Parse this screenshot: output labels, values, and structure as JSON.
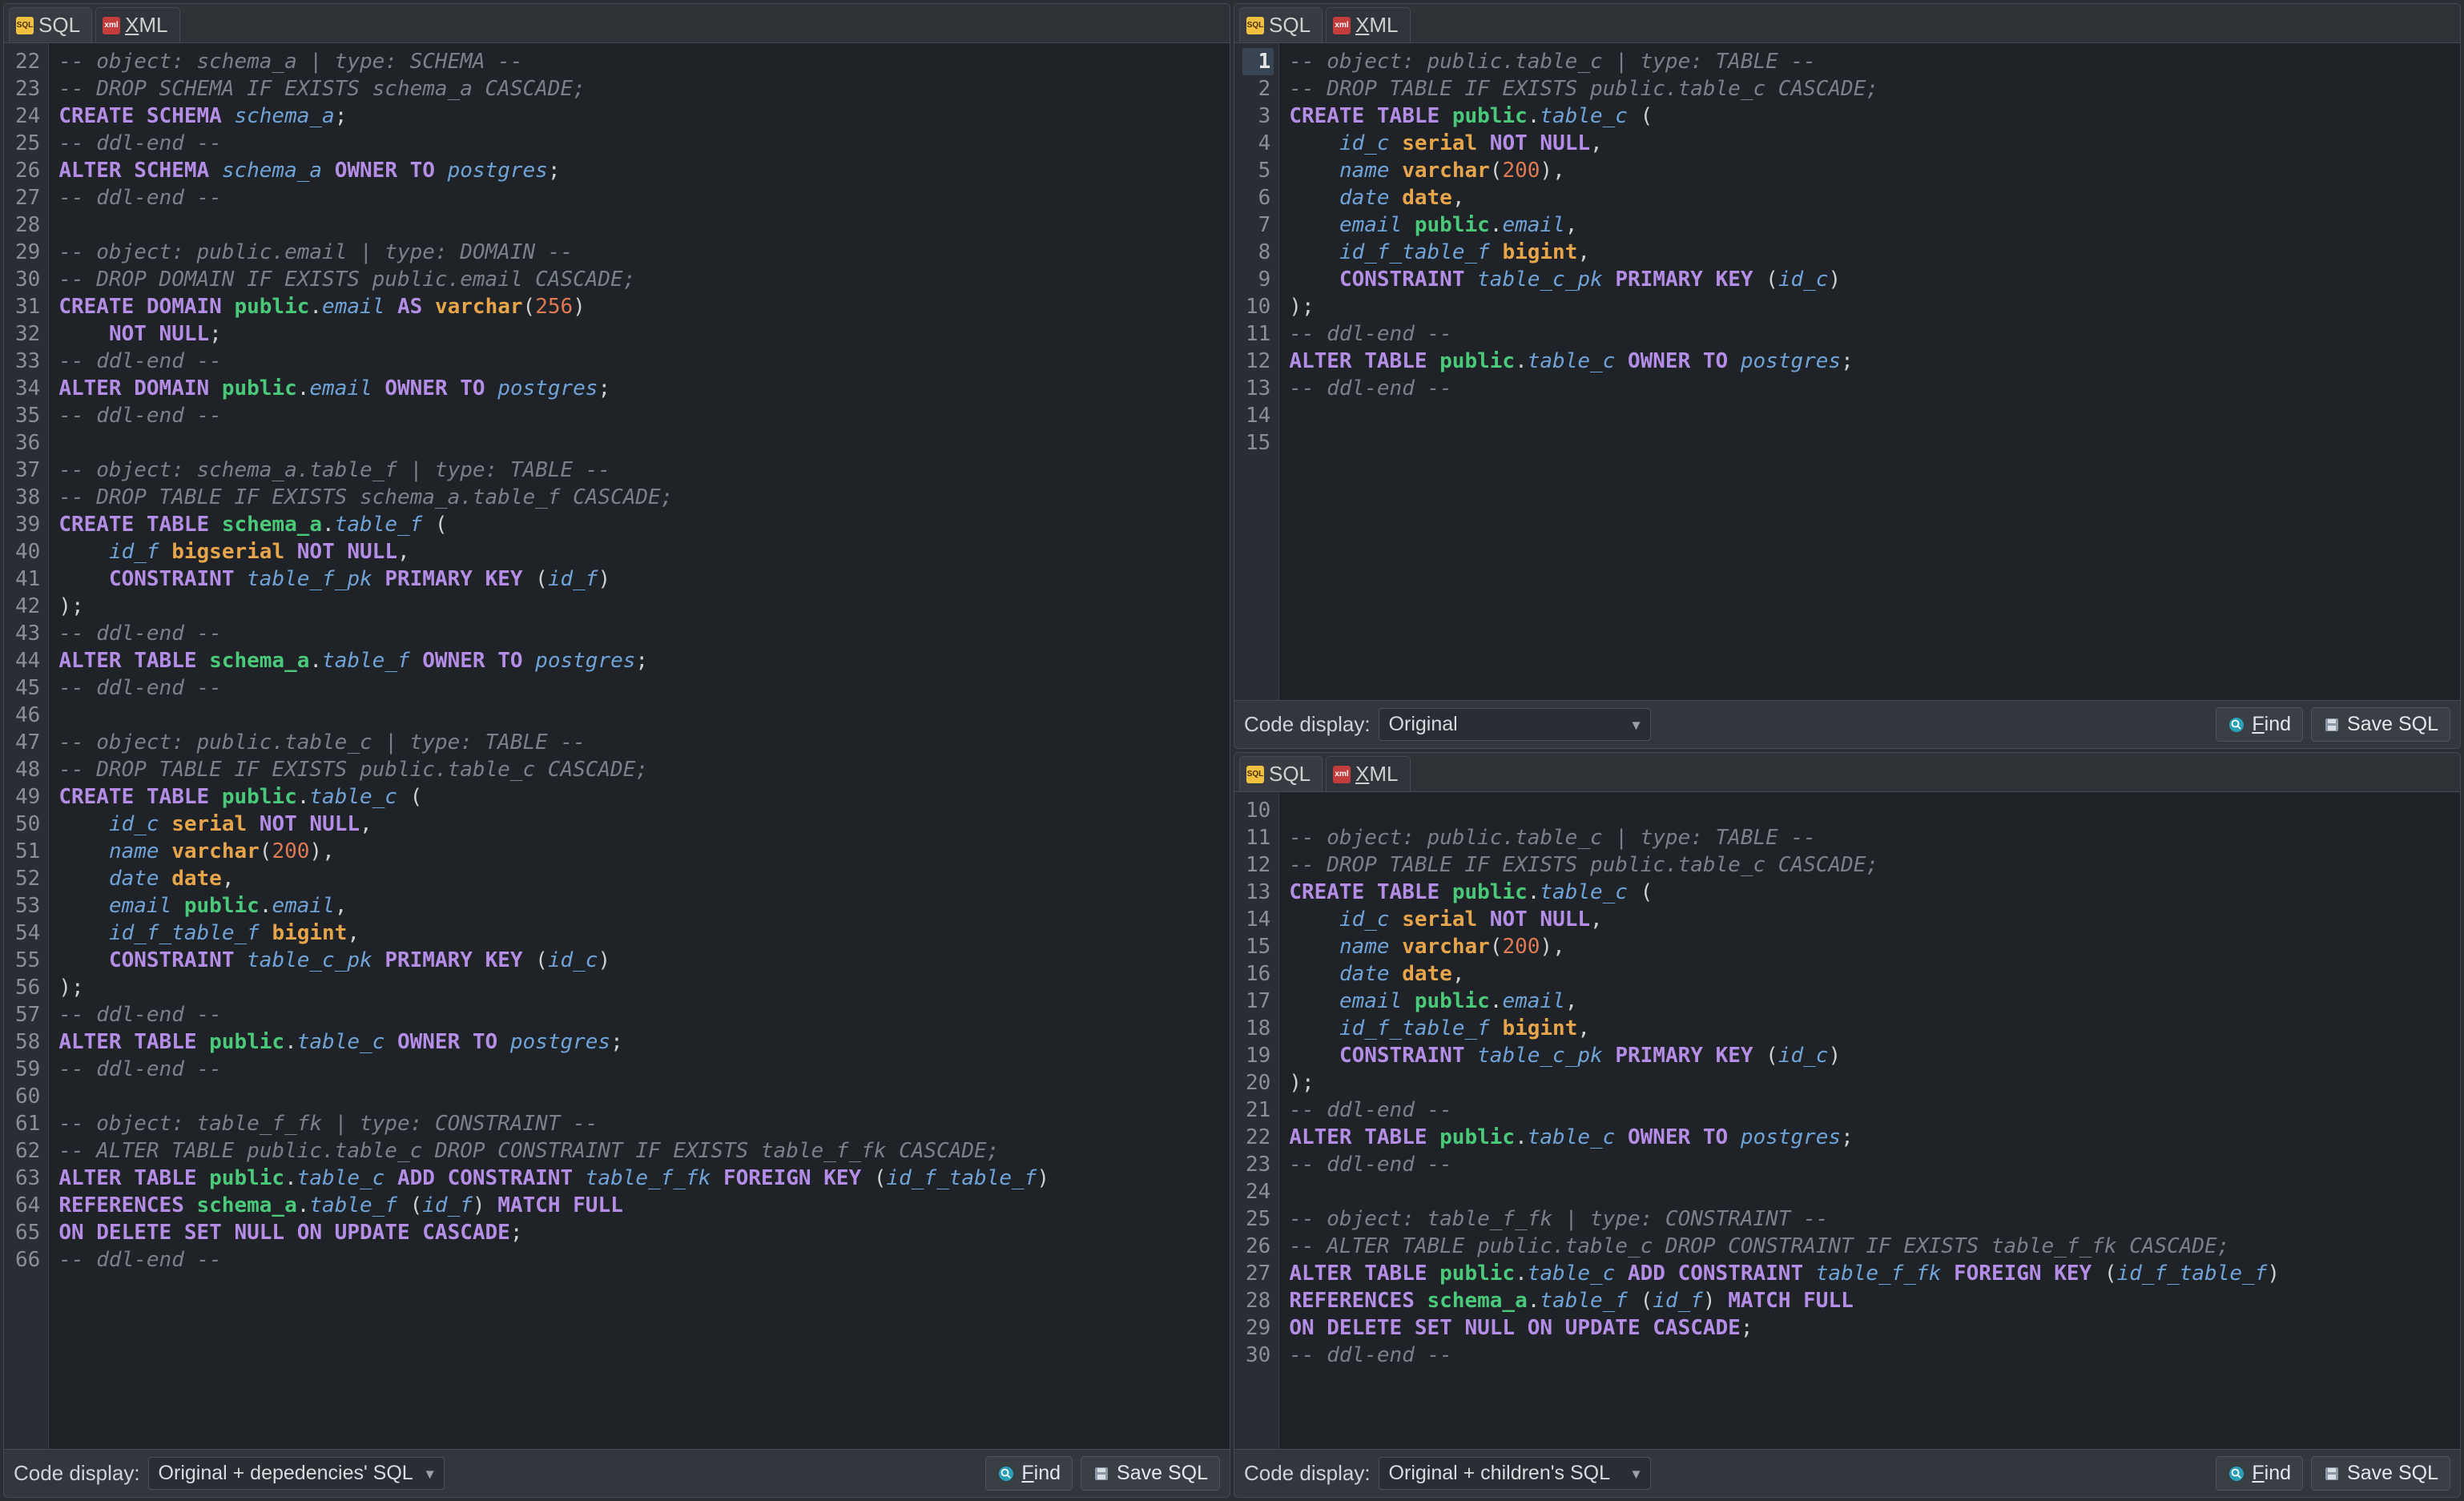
{
  "tabs": {
    "sql": "SQL",
    "xml": "XML"
  },
  "footer": {
    "label": "Code display:",
    "find": "Find",
    "save": "Save SQL"
  },
  "panelA": {
    "select": "Original",
    "startLine": 1,
    "highlightLine": 1,
    "lines": [
      [
        [
          "cm",
          "-- object: public.table_c | type: TABLE --"
        ]
      ],
      [
        [
          "cm",
          "-- DROP TABLE IF EXISTS public.table_c CASCADE;"
        ]
      ],
      [
        [
          "kw",
          "CREATE TABLE "
        ],
        [
          "sch",
          "public"
        ],
        [
          "pun",
          "."
        ],
        [
          "id",
          "table_c"
        ],
        [
          "pun",
          " ("
        ]
      ],
      [
        [
          "pun",
          "    "
        ],
        [
          "id",
          "id_c"
        ],
        [
          "pun",
          " "
        ],
        [
          "ty",
          "serial"
        ],
        [
          "pun",
          " "
        ],
        [
          "kw",
          "NOT NULL"
        ],
        [
          "pun",
          ","
        ]
      ],
      [
        [
          "pun",
          "    "
        ],
        [
          "id",
          "name"
        ],
        [
          "pun",
          " "
        ],
        [
          "ty",
          "varchar"
        ],
        [
          "pun",
          "("
        ],
        [
          "num",
          "200"
        ],
        [
          "pun",
          "),"
        ]
      ],
      [
        [
          "pun",
          "    "
        ],
        [
          "id",
          "date"
        ],
        [
          "pun",
          " "
        ],
        [
          "ty",
          "date"
        ],
        [
          "pun",
          ","
        ]
      ],
      [
        [
          "pun",
          "    "
        ],
        [
          "id",
          "email"
        ],
        [
          "pun",
          " "
        ],
        [
          "sch",
          "public"
        ],
        [
          "pun",
          "."
        ],
        [
          "id",
          "email"
        ],
        [
          "pun",
          ","
        ]
      ],
      [
        [
          "pun",
          "    "
        ],
        [
          "id",
          "id_f_table_f"
        ],
        [
          "pun",
          " "
        ],
        [
          "ty",
          "bigint"
        ],
        [
          "pun",
          ","
        ]
      ],
      [
        [
          "pun",
          "    "
        ],
        [
          "kw",
          "CONSTRAINT"
        ],
        [
          "pun",
          " "
        ],
        [
          "id",
          "table_c_pk"
        ],
        [
          "pun",
          " "
        ],
        [
          "kw",
          "PRIMARY KEY"
        ],
        [
          "pun",
          " ("
        ],
        [
          "id",
          "id_c"
        ],
        [
          "pun",
          ")"
        ]
      ],
      [
        [
          "pun",
          ");"
        ]
      ],
      [
        [
          "cm",
          "-- ddl-end --"
        ]
      ],
      [
        [
          "kw",
          "ALTER TABLE "
        ],
        [
          "sch",
          "public"
        ],
        [
          "pun",
          "."
        ],
        [
          "id",
          "table_c"
        ],
        [
          "pun",
          " "
        ],
        [
          "kw",
          "OWNER TO"
        ],
        [
          "pun",
          " "
        ],
        [
          "id",
          "postgres"
        ],
        [
          "pun",
          ";"
        ]
      ],
      [
        [
          "cm",
          "-- ddl-end --"
        ]
      ],
      [],
      []
    ]
  },
  "panelB": {
    "select": "Original + children's SQL",
    "startLine": 10,
    "highlightLine": null,
    "lines": [
      [],
      [
        [
          "cm",
          "-- object: public.table_c | type: TABLE --"
        ]
      ],
      [
        [
          "cm",
          "-- DROP TABLE IF EXISTS public.table_c CASCADE;"
        ]
      ],
      [
        [
          "kw",
          "CREATE TABLE "
        ],
        [
          "sch",
          "public"
        ],
        [
          "pun",
          "."
        ],
        [
          "id",
          "table_c"
        ],
        [
          "pun",
          " ("
        ]
      ],
      [
        [
          "pun",
          "    "
        ],
        [
          "id",
          "id_c"
        ],
        [
          "pun",
          " "
        ],
        [
          "ty",
          "serial"
        ],
        [
          "pun",
          " "
        ],
        [
          "kw",
          "NOT NULL"
        ],
        [
          "pun",
          ","
        ]
      ],
      [
        [
          "pun",
          "    "
        ],
        [
          "id",
          "name"
        ],
        [
          "pun",
          " "
        ],
        [
          "ty",
          "varchar"
        ],
        [
          "pun",
          "("
        ],
        [
          "num",
          "200"
        ],
        [
          "pun",
          "),"
        ]
      ],
      [
        [
          "pun",
          "    "
        ],
        [
          "id",
          "date"
        ],
        [
          "pun",
          " "
        ],
        [
          "ty",
          "date"
        ],
        [
          "pun",
          ","
        ]
      ],
      [
        [
          "pun",
          "    "
        ],
        [
          "id",
          "email"
        ],
        [
          "pun",
          " "
        ],
        [
          "sch",
          "public"
        ],
        [
          "pun",
          "."
        ],
        [
          "id",
          "email"
        ],
        [
          "pun",
          ","
        ]
      ],
      [
        [
          "pun",
          "    "
        ],
        [
          "id",
          "id_f_table_f"
        ],
        [
          "pun",
          " "
        ],
        [
          "ty",
          "bigint"
        ],
        [
          "pun",
          ","
        ]
      ],
      [
        [
          "pun",
          "    "
        ],
        [
          "kw",
          "CONSTRAINT"
        ],
        [
          "pun",
          " "
        ],
        [
          "id",
          "table_c_pk"
        ],
        [
          "pun",
          " "
        ],
        [
          "kw",
          "PRIMARY KEY"
        ],
        [
          "pun",
          " ("
        ],
        [
          "id",
          "id_c"
        ],
        [
          "pun",
          ")"
        ]
      ],
      [
        [
          "pun",
          ");"
        ]
      ],
      [
        [
          "cm",
          "-- ddl-end --"
        ]
      ],
      [
        [
          "kw",
          "ALTER TABLE "
        ],
        [
          "sch",
          "public"
        ],
        [
          "pun",
          "."
        ],
        [
          "id",
          "table_c"
        ],
        [
          "pun",
          " "
        ],
        [
          "kw",
          "OWNER TO"
        ],
        [
          "pun",
          " "
        ],
        [
          "id",
          "postgres"
        ],
        [
          "pun",
          ";"
        ]
      ],
      [
        [
          "cm",
          "-- ddl-end --"
        ]
      ],
      [],
      [
        [
          "cm",
          "-- object: table_f_fk | type: CONSTRAINT --"
        ]
      ],
      [
        [
          "cm",
          "-- ALTER TABLE public.table_c DROP CONSTRAINT IF EXISTS table_f_fk CASCADE;"
        ]
      ],
      [
        [
          "kw",
          "ALTER TABLE "
        ],
        [
          "sch",
          "public"
        ],
        [
          "pun",
          "."
        ],
        [
          "id",
          "table_c"
        ],
        [
          "pun",
          " "
        ],
        [
          "kw",
          "ADD CONSTRAINT"
        ],
        [
          "pun",
          " "
        ],
        [
          "id",
          "table_f_fk"
        ],
        [
          "pun",
          " "
        ],
        [
          "kw",
          "FOREIGN KEY"
        ],
        [
          "pun",
          " ("
        ],
        [
          "id",
          "id_f_table_f"
        ],
        [
          "pun",
          ")"
        ]
      ],
      [
        [
          "kw",
          "REFERENCES "
        ],
        [
          "sch",
          "schema_a"
        ],
        [
          "pun",
          "."
        ],
        [
          "id",
          "table_f"
        ],
        [
          "pun",
          " ("
        ],
        [
          "id",
          "id_f"
        ],
        [
          "pun",
          ") "
        ],
        [
          "kw",
          "MATCH FULL"
        ]
      ],
      [
        [
          "kw",
          "ON DELETE SET NULL ON UPDATE CASCADE"
        ],
        [
          "pun",
          ";"
        ]
      ],
      [
        [
          "cm",
          "-- ddl-end --"
        ]
      ]
    ]
  },
  "panelC": {
    "select": "Original + depedencies' SQL",
    "startLine": 22,
    "highlightLine": null,
    "lines": [
      [
        [
          "cm",
          "-- object: schema_a | type: SCHEMA --"
        ]
      ],
      [
        [
          "cm",
          "-- DROP SCHEMA IF EXISTS schema_a CASCADE;"
        ]
      ],
      [
        [
          "kw",
          "CREATE SCHEMA "
        ],
        [
          "id",
          "schema_a"
        ],
        [
          "pun",
          ";"
        ]
      ],
      [
        [
          "cm",
          "-- ddl-end --"
        ]
      ],
      [
        [
          "kw",
          "ALTER SCHEMA "
        ],
        [
          "id",
          "schema_a"
        ],
        [
          "pun",
          " "
        ],
        [
          "kw",
          "OWNER TO"
        ],
        [
          "pun",
          " "
        ],
        [
          "id",
          "postgres"
        ],
        [
          "pun",
          ";"
        ]
      ],
      [
        [
          "cm",
          "-- ddl-end --"
        ]
      ],
      [],
      [
        [
          "cm",
          "-- object: public.email | type: DOMAIN --"
        ]
      ],
      [
        [
          "cm",
          "-- DROP DOMAIN IF EXISTS public.email CASCADE;"
        ]
      ],
      [
        [
          "kw",
          "CREATE DOMAIN "
        ],
        [
          "sch",
          "public"
        ],
        [
          "pun",
          "."
        ],
        [
          "id",
          "email"
        ],
        [
          "pun",
          " "
        ],
        [
          "kw",
          "AS"
        ],
        [
          "pun",
          " "
        ],
        [
          "ty",
          "varchar"
        ],
        [
          "pun",
          "("
        ],
        [
          "num",
          "256"
        ],
        [
          "pun",
          ")"
        ]
      ],
      [
        [
          "pun",
          "    "
        ],
        [
          "kw",
          "NOT NULL"
        ],
        [
          "pun",
          ";"
        ]
      ],
      [
        [
          "cm",
          "-- ddl-end --"
        ]
      ],
      [
        [
          "kw",
          "ALTER DOMAIN "
        ],
        [
          "sch",
          "public"
        ],
        [
          "pun",
          "."
        ],
        [
          "id",
          "email"
        ],
        [
          "pun",
          " "
        ],
        [
          "kw",
          "OWNER TO"
        ],
        [
          "pun",
          " "
        ],
        [
          "id",
          "postgres"
        ],
        [
          "pun",
          ";"
        ]
      ],
      [
        [
          "cm",
          "-- ddl-end --"
        ]
      ],
      [],
      [
        [
          "cm",
          "-- object: schema_a.table_f | type: TABLE --"
        ]
      ],
      [
        [
          "cm",
          "-- DROP TABLE IF EXISTS schema_a.table_f CASCADE;"
        ]
      ],
      [
        [
          "kw",
          "CREATE TABLE "
        ],
        [
          "sch",
          "schema_a"
        ],
        [
          "pun",
          "."
        ],
        [
          "id",
          "table_f"
        ],
        [
          "pun",
          " ("
        ]
      ],
      [
        [
          "pun",
          "    "
        ],
        [
          "id",
          "id_f"
        ],
        [
          "pun",
          " "
        ],
        [
          "ty",
          "bigserial"
        ],
        [
          "pun",
          " "
        ],
        [
          "kw",
          "NOT NULL"
        ],
        [
          "pun",
          ","
        ]
      ],
      [
        [
          "pun",
          "    "
        ],
        [
          "kw",
          "CONSTRAINT"
        ],
        [
          "pun",
          " "
        ],
        [
          "id",
          "table_f_pk"
        ],
        [
          "pun",
          " "
        ],
        [
          "kw",
          "PRIMARY KEY"
        ],
        [
          "pun",
          " ("
        ],
        [
          "id",
          "id_f"
        ],
        [
          "pun",
          ")"
        ]
      ],
      [
        [
          "pun",
          ");"
        ]
      ],
      [
        [
          "cm",
          "-- ddl-end --"
        ]
      ],
      [
        [
          "kw",
          "ALTER TABLE "
        ],
        [
          "sch",
          "schema_a"
        ],
        [
          "pun",
          "."
        ],
        [
          "id",
          "table_f"
        ],
        [
          "pun",
          " "
        ],
        [
          "kw",
          "OWNER TO"
        ],
        [
          "pun",
          " "
        ],
        [
          "id",
          "postgres"
        ],
        [
          "pun",
          ";"
        ]
      ],
      [
        [
          "cm",
          "-- ddl-end --"
        ]
      ],
      [],
      [
        [
          "cm",
          "-- object: public.table_c | type: TABLE --"
        ]
      ],
      [
        [
          "cm",
          "-- DROP TABLE IF EXISTS public.table_c CASCADE;"
        ]
      ],
      [
        [
          "kw",
          "CREATE TABLE "
        ],
        [
          "sch",
          "public"
        ],
        [
          "pun",
          "."
        ],
        [
          "id",
          "table_c"
        ],
        [
          "pun",
          " ("
        ]
      ],
      [
        [
          "pun",
          "    "
        ],
        [
          "id",
          "id_c"
        ],
        [
          "pun",
          " "
        ],
        [
          "ty",
          "serial"
        ],
        [
          "pun",
          " "
        ],
        [
          "kw",
          "NOT NULL"
        ],
        [
          "pun",
          ","
        ]
      ],
      [
        [
          "pun",
          "    "
        ],
        [
          "id",
          "name"
        ],
        [
          "pun",
          " "
        ],
        [
          "ty",
          "varchar"
        ],
        [
          "pun",
          "("
        ],
        [
          "num",
          "200"
        ],
        [
          "pun",
          "),"
        ]
      ],
      [
        [
          "pun",
          "    "
        ],
        [
          "id",
          "date"
        ],
        [
          "pun",
          " "
        ],
        [
          "ty",
          "date"
        ],
        [
          "pun",
          ","
        ]
      ],
      [
        [
          "pun",
          "    "
        ],
        [
          "id",
          "email"
        ],
        [
          "pun",
          " "
        ],
        [
          "sch",
          "public"
        ],
        [
          "pun",
          "."
        ],
        [
          "id",
          "email"
        ],
        [
          "pun",
          ","
        ]
      ],
      [
        [
          "pun",
          "    "
        ],
        [
          "id",
          "id_f_table_f"
        ],
        [
          "pun",
          " "
        ],
        [
          "ty",
          "bigint"
        ],
        [
          "pun",
          ","
        ]
      ],
      [
        [
          "pun",
          "    "
        ],
        [
          "kw",
          "CONSTRAINT"
        ],
        [
          "pun",
          " "
        ],
        [
          "id",
          "table_c_pk"
        ],
        [
          "pun",
          " "
        ],
        [
          "kw",
          "PRIMARY KEY"
        ],
        [
          "pun",
          " ("
        ],
        [
          "id",
          "id_c"
        ],
        [
          "pun",
          ")"
        ]
      ],
      [
        [
          "pun",
          ");"
        ]
      ],
      [
        [
          "cm",
          "-- ddl-end --"
        ]
      ],
      [
        [
          "kw",
          "ALTER TABLE "
        ],
        [
          "sch",
          "public"
        ],
        [
          "pun",
          "."
        ],
        [
          "id",
          "table_c"
        ],
        [
          "pun",
          " "
        ],
        [
          "kw",
          "OWNER TO"
        ],
        [
          "pun",
          " "
        ],
        [
          "id",
          "postgres"
        ],
        [
          "pun",
          ";"
        ]
      ],
      [
        [
          "cm",
          "-- ddl-end --"
        ]
      ],
      [],
      [
        [
          "cm",
          "-- object: table_f_fk | type: CONSTRAINT --"
        ]
      ],
      [
        [
          "cm",
          "-- ALTER TABLE public.table_c DROP CONSTRAINT IF EXISTS table_f_fk CASCADE;"
        ]
      ],
      [
        [
          "kw",
          "ALTER TABLE "
        ],
        [
          "sch",
          "public"
        ],
        [
          "pun",
          "."
        ],
        [
          "id",
          "table_c"
        ],
        [
          "pun",
          " "
        ],
        [
          "kw",
          "ADD CONSTRAINT"
        ],
        [
          "pun",
          " "
        ],
        [
          "id",
          "table_f_fk"
        ],
        [
          "pun",
          " "
        ],
        [
          "kw",
          "FOREIGN KEY"
        ],
        [
          "pun",
          " ("
        ],
        [
          "id",
          "id_f_table_f"
        ],
        [
          "pun",
          ")"
        ]
      ],
      [
        [
          "kw",
          "REFERENCES "
        ],
        [
          "sch",
          "schema_a"
        ],
        [
          "pun",
          "."
        ],
        [
          "id",
          "table_f"
        ],
        [
          "pun",
          " ("
        ],
        [
          "id",
          "id_f"
        ],
        [
          "pun",
          ") "
        ],
        [
          "kw",
          "MATCH FULL"
        ]
      ],
      [
        [
          "kw",
          "ON DELETE SET NULL ON UPDATE CASCADE"
        ],
        [
          "pun",
          ";"
        ]
      ],
      [
        [
          "cm",
          "-- ddl-end --"
        ]
      ]
    ]
  }
}
